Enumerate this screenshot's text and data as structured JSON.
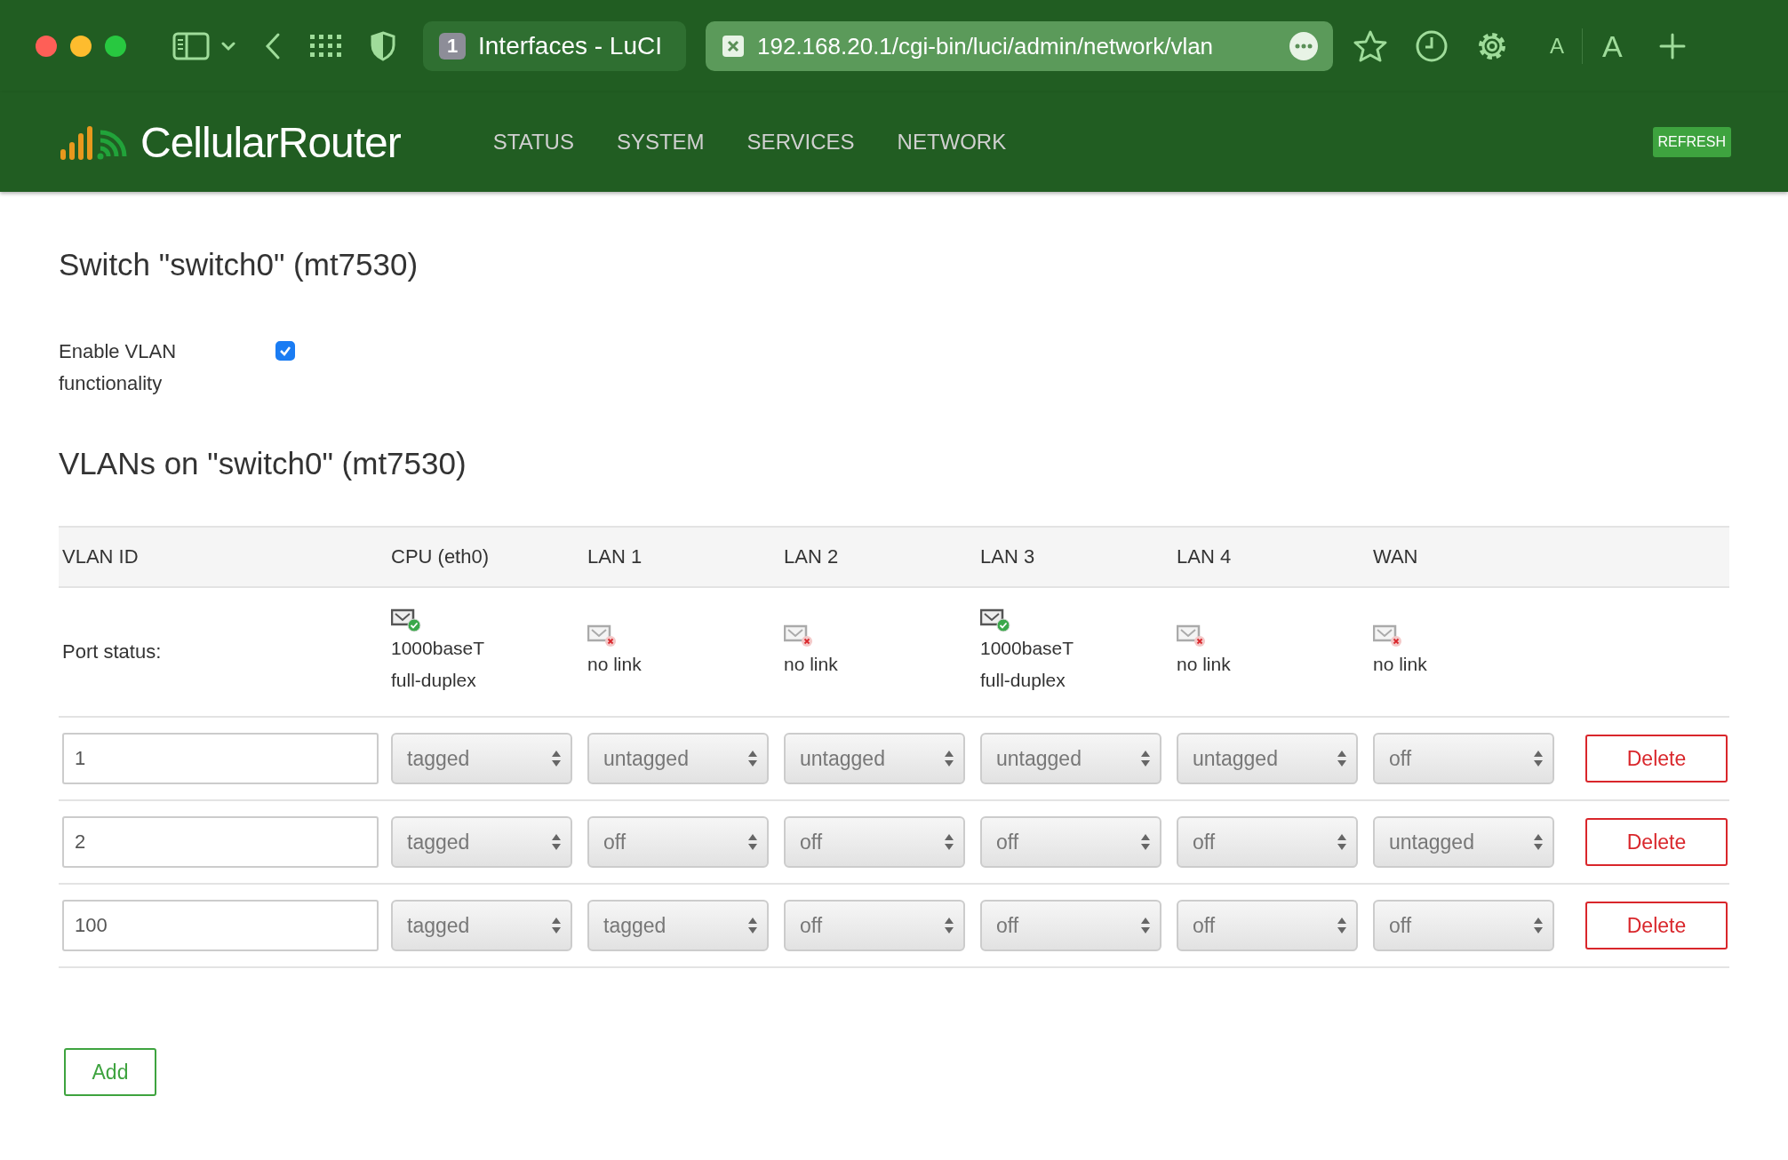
{
  "browser": {
    "tabs": [
      {
        "badge": "1",
        "label": "Interfaces - LuCI",
        "selected": false
      },
      {
        "label": "192.168.20.1/cgi-bin/luci/admin/network/vlan",
        "selected": true
      }
    ],
    "font_buttons": [
      "A",
      "A"
    ]
  },
  "header": {
    "brand": "CellularRouter",
    "nav": [
      "STATUS",
      "SYSTEM",
      "SERVICES",
      "NETWORK"
    ],
    "refresh": "REFRESH"
  },
  "switch": {
    "title": "Switch \"switch0\" (mt7530)",
    "enable_vlan": {
      "label": "Enable VLAN functionality",
      "checked": true
    }
  },
  "vlans": {
    "title": "VLANs on \"switch0\" (mt7530)",
    "columns": [
      "VLAN ID",
      "CPU (eth0)",
      "LAN 1",
      "LAN 2",
      "LAN 3",
      "LAN 4",
      "WAN"
    ],
    "port_status_label": "Port status:",
    "port_status": [
      {
        "link": true,
        "lines": [
          "1000baseT",
          "full-duplex"
        ]
      },
      {
        "link": false,
        "lines": [
          "no link"
        ]
      },
      {
        "link": false,
        "lines": [
          "no link"
        ]
      },
      {
        "link": true,
        "lines": [
          "1000baseT",
          "full-duplex"
        ]
      },
      {
        "link": false,
        "lines": [
          "no link"
        ]
      },
      {
        "link": false,
        "lines": [
          "no link"
        ]
      }
    ],
    "rows": [
      {
        "vlan_id": "1",
        "ports": [
          "tagged",
          "untagged",
          "untagged",
          "untagged",
          "untagged",
          "off"
        ],
        "delete": "Delete"
      },
      {
        "vlan_id": "2",
        "ports": [
          "tagged",
          "off",
          "off",
          "off",
          "off",
          "untagged"
        ],
        "delete": "Delete"
      },
      {
        "vlan_id": "100",
        "ports": [
          "tagged",
          "tagged",
          "off",
          "off",
          "off",
          "off"
        ],
        "delete": "Delete"
      }
    ],
    "add": "Add"
  }
}
